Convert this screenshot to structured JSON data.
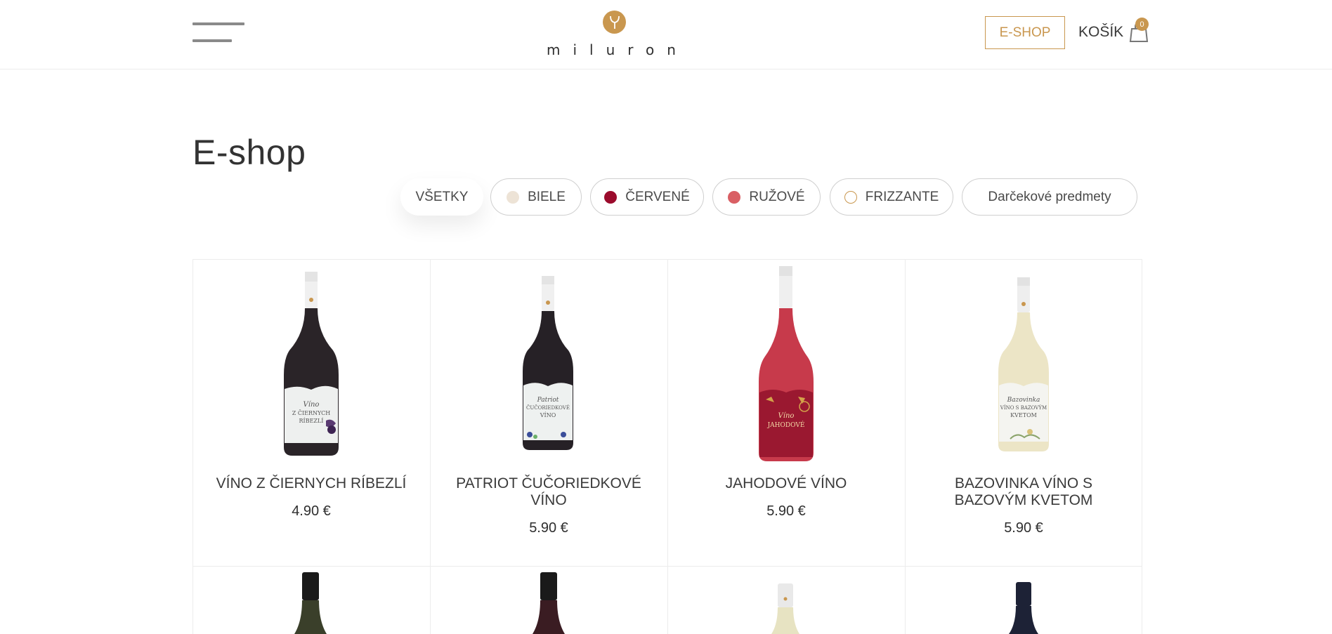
{
  "header": {
    "logo_text": "miluron",
    "eshop_label": "E-SHOP",
    "cart_label": "KOŠÍK",
    "cart_count": "0",
    "accent_color": "#c9974f"
  },
  "page": {
    "title": "E-shop"
  },
  "filters": [
    {
      "label": "VŠETKY",
      "active": true
    },
    {
      "label": "BIELE",
      "dot_color": "#ede3d6"
    },
    {
      "label": "ČERVENÉ",
      "dot_color": "#9b0b2c"
    },
    {
      "label": "RUŽOVÉ",
      "dot_color": "#d95f64"
    },
    {
      "label": "FRIZZANTE",
      "dot_color": "outline-#c9974f"
    },
    {
      "label": "Darčekové predmety"
    }
  ],
  "products": [
    {
      "name": "VÍNO Z ČIERNYCH RÍBEZLÍ",
      "price": "4.90 €",
      "bottle_color": "#2a2428",
      "label_text": "Víno Z ČIERNYCH RÍBEZLÍ"
    },
    {
      "name": "PATRIOT ČUČORIEDKOVÉ VÍNO",
      "price": "5.90 €",
      "bottle_color": "#262126",
      "label_text": "Patriot ČUČORIEDKOVÉ VÍNO"
    },
    {
      "name": "JAHODOVÉ VÍNO",
      "price": "5.90 €",
      "bottle_color": "#c73a4b",
      "label_text": "Víno JAHODOVÉ"
    },
    {
      "name": "BAZOVINKA VÍNO S BAZOVÝM KVETOM",
      "price": "5.90 €",
      "bottle_color": "#ece5c6",
      "label_text": "Bazovinka VÍNO S BAZOVÝM KVETOM"
    }
  ],
  "second_row_bottles": [
    {
      "bottle_color": "#3a3f2a",
      "cap_color": "#1a1a1a"
    },
    {
      "bottle_color": "#3a1c22",
      "cap_color": "#1a1a1a"
    },
    {
      "bottle_color": "#e7e3c2",
      "cap_color": "#e9e9e9"
    },
    {
      "bottle_color": "#1d2236",
      "cap_color": "#1d2236"
    }
  ]
}
